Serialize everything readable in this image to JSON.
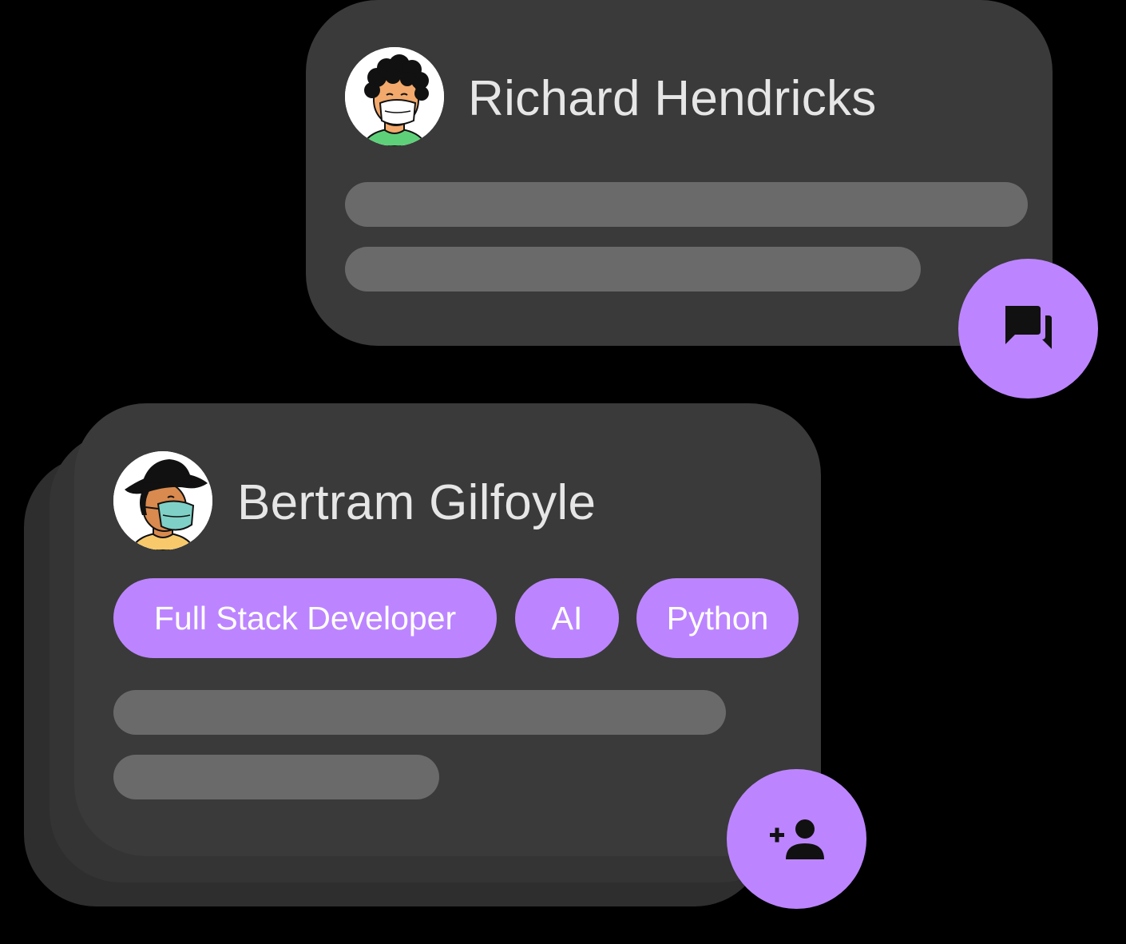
{
  "cards": [
    {
      "name": "Richard Hendricks",
      "avatar_icon": "avatar-masked-curly-hair",
      "action_icon": "chat-bubbles-icon"
    },
    {
      "name": "Bertram Gilfoyle",
      "avatar_icon": "avatar-masked-hat",
      "tags": [
        "Full Stack Developer",
        "AI",
        "Python"
      ],
      "action_icon": "add-person-icon"
    }
  ],
  "colors": {
    "background": "#000000",
    "card": "#3a3a3a",
    "skeleton": "#6a6a6a",
    "accent": "#bc85ff",
    "name_text": "#e6e6e6"
  }
}
